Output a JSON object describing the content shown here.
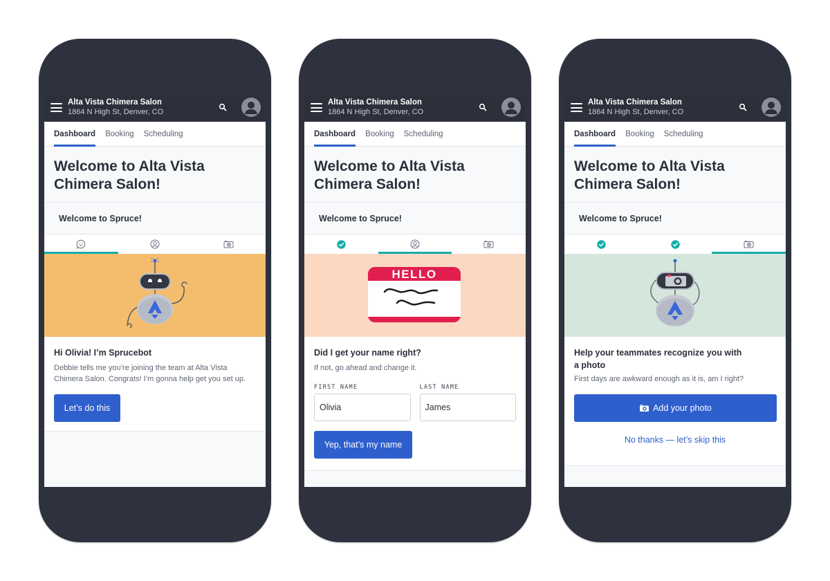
{
  "app": {
    "business_name": "Alta Vista Chimera Salon",
    "business_address": "1864 N High St, Denver, CO",
    "nav_tabs": [
      "Dashboard",
      "Booking",
      "Scheduling"
    ],
    "active_nav_tab": "Dashboard",
    "welcome_title": "Welcome to Alta Vista Chimera Salon!",
    "spruce_banner": "Welcome to Spruce!"
  },
  "colors": {
    "primary": "#2e5fcc",
    "teal": "#14aea8",
    "appbar": "#2b303b",
    "hero_step1": "#f4bd6e",
    "hero_step2": "#fbd8c2",
    "hero_step3": "#d5e6dc"
  },
  "screens": [
    {
      "steps": [
        {
          "icon": "chat-smile-icon",
          "state": "active"
        },
        {
          "icon": "user-circle-icon",
          "state": "pending"
        },
        {
          "icon": "camera-icon",
          "state": "pending"
        }
      ],
      "hero": "sprucebot-waving-illustration",
      "title": "Hi Olivia! I’m Sprucebot",
      "text": "Debbie tells me you’re joining the team at Alta Vista Chimera Salon. Congrats! I’m gonna help get you set up.",
      "button": "Let’s do this"
    },
    {
      "steps": [
        {
          "icon": "check-circle-icon",
          "state": "done"
        },
        {
          "icon": "user-circle-icon",
          "state": "active"
        },
        {
          "icon": "camera-icon",
          "state": "pending"
        }
      ],
      "hero": "hello-name-tag-illustration",
      "hero_tag_text": "HELLO",
      "title": "Did I get your name right?",
      "text": "If not, go ahead and change it.",
      "fields": [
        {
          "label": "FIRST NAME",
          "value": "Olivia"
        },
        {
          "label": "LAST NAME",
          "value": "James"
        }
      ],
      "button": "Yep, that’s my name"
    },
    {
      "steps": [
        {
          "icon": "check-circle-icon",
          "state": "done"
        },
        {
          "icon": "check-circle-icon",
          "state": "done"
        },
        {
          "icon": "camera-icon",
          "state": "active"
        }
      ],
      "hero": "sprucebot-camera-illustration",
      "title": "Help your teammates recognize you with a photo",
      "text": "First days are awkward enough as it is, am I right?",
      "button": "Add your photo",
      "button_icon": "camera-icon",
      "link": "No thanks — let’s skip this"
    }
  ]
}
